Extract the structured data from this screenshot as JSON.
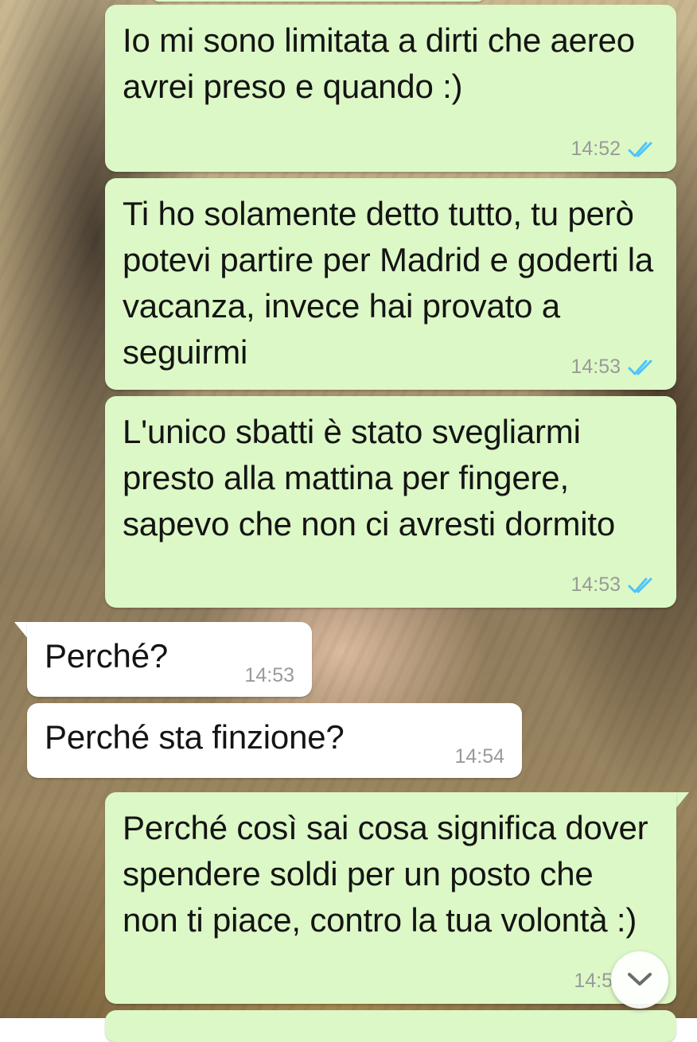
{
  "messages": [
    {
      "direction": "outgoing",
      "text": "Io mi sono limitata a dirti che aereo avrei preso e quando :)",
      "time": "14:52",
      "status": "read-double-check-icon"
    },
    {
      "direction": "outgoing",
      "text": "Ti ho solamente detto tutto, tu però potevi partire per Madrid e goderti la vacanza, invece hai provato a seguirmi",
      "time": "14:53",
      "status": "read-double-check-icon"
    },
    {
      "direction": "outgoing",
      "text": "L'unico sbatti è stato svegliarmi presto alla mattina per fingere, sapevo che non ci avresti dormito",
      "time": "14:53",
      "status": "read-double-check-icon"
    },
    {
      "direction": "incoming",
      "text": "Perché?",
      "time": "14:53"
    },
    {
      "direction": "incoming",
      "text": "Perché sta finzione?",
      "time": "14:54"
    },
    {
      "direction": "outgoing",
      "text": "Perché così sai cosa significa dover spendere soldi per un posto che non ti piace, contro la tua volontà :)",
      "time": "14:5",
      "status": "read-double-check-icon"
    }
  ],
  "colors": {
    "outgoing_bubble": "#dcf8c6",
    "incoming_bubble": "#ffffff",
    "read_ticks": "#4fc3f7",
    "timestamp": "#9a9a9a"
  },
  "scroll_button": {
    "icon": "chevron-down-icon"
  }
}
